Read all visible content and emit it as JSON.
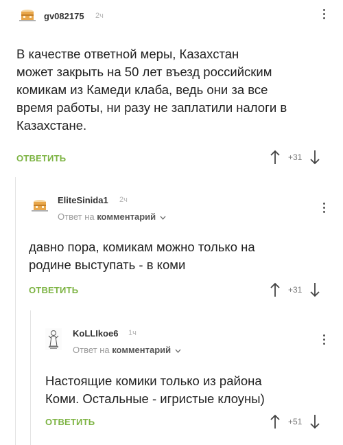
{
  "comments": [
    {
      "username": "gv082175",
      "time": "2ч",
      "text_lines": [
        "В качестве ответной меры, Казахстан",
        "может закрыть на 50 лет въезд российским",
        "комикам из Камеди клаба, ведь они за все",
        "время работы, ни разу не заплатили налоги в",
        "Казахстане."
      ],
      "reply_label": "ОТВЕТИТЬ",
      "score": "+31",
      "avatar_icon": "cake-avatar-icon"
    },
    {
      "username": "EliteSinida1",
      "time": "2ч",
      "reply_to_prefix": "Ответ на",
      "reply_to_link": "комментарий",
      "text_lines": [
        "давно пора, комикам можно только на",
        "родине выступать - в коми"
      ],
      "reply_label": "ОТВЕТИТЬ",
      "score": "+31",
      "avatar_icon": "cake-avatar-icon"
    },
    {
      "username": "KoLLIkoe6",
      "time": "1ч",
      "reply_to_prefix": "Ответ на",
      "reply_to_link": "комментарий",
      "text_lines": [
        "Настоящие комики только из района",
        "Коми. Остальные - игристые клоуны)"
      ],
      "reply_label": "ОТВЕТИТЬ",
      "score": "+51",
      "avatar_icon": "statue-avatar-icon"
    }
  ],
  "colors": {
    "reply_green": "#7cb342",
    "meta_gray": "#9a9a9a",
    "thread_line": "#e3e3e3"
  }
}
